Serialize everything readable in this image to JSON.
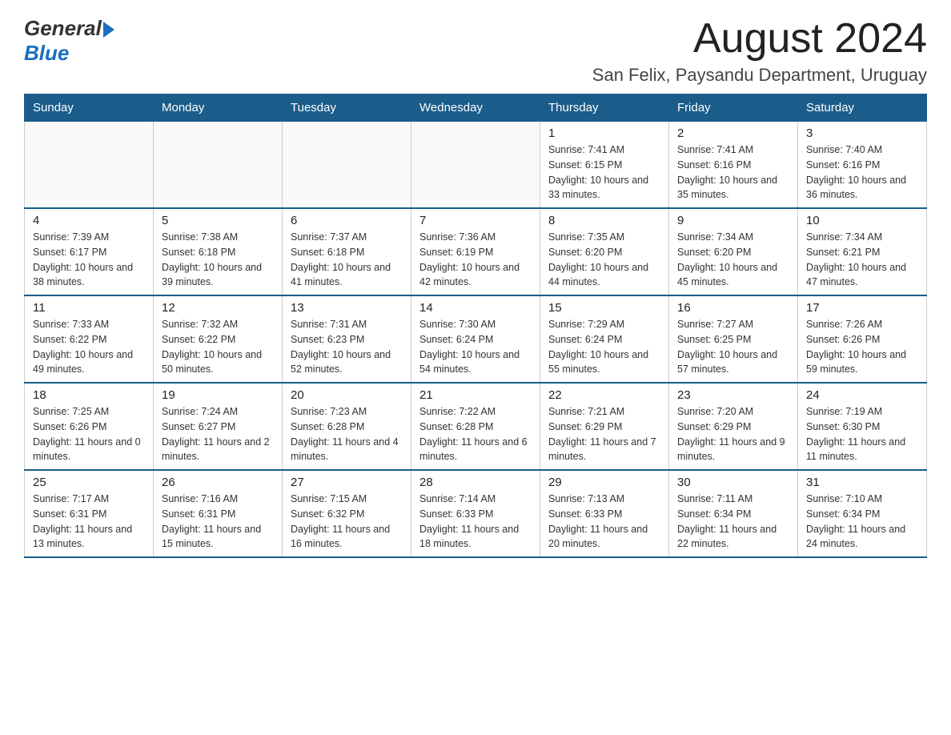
{
  "header": {
    "logo_general": "General",
    "logo_blue": "Blue",
    "month_title": "August 2024",
    "location": "San Felix, Paysandu Department, Uruguay"
  },
  "weekdays": [
    "Sunday",
    "Monday",
    "Tuesday",
    "Wednesday",
    "Thursday",
    "Friday",
    "Saturday"
  ],
  "weeks": [
    [
      {
        "day": "",
        "info": ""
      },
      {
        "day": "",
        "info": ""
      },
      {
        "day": "",
        "info": ""
      },
      {
        "day": "",
        "info": ""
      },
      {
        "day": "1",
        "info": "Sunrise: 7:41 AM\nSunset: 6:15 PM\nDaylight: 10 hours and 33 minutes."
      },
      {
        "day": "2",
        "info": "Sunrise: 7:41 AM\nSunset: 6:16 PM\nDaylight: 10 hours and 35 minutes."
      },
      {
        "day": "3",
        "info": "Sunrise: 7:40 AM\nSunset: 6:16 PM\nDaylight: 10 hours and 36 minutes."
      }
    ],
    [
      {
        "day": "4",
        "info": "Sunrise: 7:39 AM\nSunset: 6:17 PM\nDaylight: 10 hours and 38 minutes."
      },
      {
        "day": "5",
        "info": "Sunrise: 7:38 AM\nSunset: 6:18 PM\nDaylight: 10 hours and 39 minutes."
      },
      {
        "day": "6",
        "info": "Sunrise: 7:37 AM\nSunset: 6:18 PM\nDaylight: 10 hours and 41 minutes."
      },
      {
        "day": "7",
        "info": "Sunrise: 7:36 AM\nSunset: 6:19 PM\nDaylight: 10 hours and 42 minutes."
      },
      {
        "day": "8",
        "info": "Sunrise: 7:35 AM\nSunset: 6:20 PM\nDaylight: 10 hours and 44 minutes."
      },
      {
        "day": "9",
        "info": "Sunrise: 7:34 AM\nSunset: 6:20 PM\nDaylight: 10 hours and 45 minutes."
      },
      {
        "day": "10",
        "info": "Sunrise: 7:34 AM\nSunset: 6:21 PM\nDaylight: 10 hours and 47 minutes."
      }
    ],
    [
      {
        "day": "11",
        "info": "Sunrise: 7:33 AM\nSunset: 6:22 PM\nDaylight: 10 hours and 49 minutes."
      },
      {
        "day": "12",
        "info": "Sunrise: 7:32 AM\nSunset: 6:22 PM\nDaylight: 10 hours and 50 minutes."
      },
      {
        "day": "13",
        "info": "Sunrise: 7:31 AM\nSunset: 6:23 PM\nDaylight: 10 hours and 52 minutes."
      },
      {
        "day": "14",
        "info": "Sunrise: 7:30 AM\nSunset: 6:24 PM\nDaylight: 10 hours and 54 minutes."
      },
      {
        "day": "15",
        "info": "Sunrise: 7:29 AM\nSunset: 6:24 PM\nDaylight: 10 hours and 55 minutes."
      },
      {
        "day": "16",
        "info": "Sunrise: 7:27 AM\nSunset: 6:25 PM\nDaylight: 10 hours and 57 minutes."
      },
      {
        "day": "17",
        "info": "Sunrise: 7:26 AM\nSunset: 6:26 PM\nDaylight: 10 hours and 59 minutes."
      }
    ],
    [
      {
        "day": "18",
        "info": "Sunrise: 7:25 AM\nSunset: 6:26 PM\nDaylight: 11 hours and 0 minutes."
      },
      {
        "day": "19",
        "info": "Sunrise: 7:24 AM\nSunset: 6:27 PM\nDaylight: 11 hours and 2 minutes."
      },
      {
        "day": "20",
        "info": "Sunrise: 7:23 AM\nSunset: 6:28 PM\nDaylight: 11 hours and 4 minutes."
      },
      {
        "day": "21",
        "info": "Sunrise: 7:22 AM\nSunset: 6:28 PM\nDaylight: 11 hours and 6 minutes."
      },
      {
        "day": "22",
        "info": "Sunrise: 7:21 AM\nSunset: 6:29 PM\nDaylight: 11 hours and 7 minutes."
      },
      {
        "day": "23",
        "info": "Sunrise: 7:20 AM\nSunset: 6:29 PM\nDaylight: 11 hours and 9 minutes."
      },
      {
        "day": "24",
        "info": "Sunrise: 7:19 AM\nSunset: 6:30 PM\nDaylight: 11 hours and 11 minutes."
      }
    ],
    [
      {
        "day": "25",
        "info": "Sunrise: 7:17 AM\nSunset: 6:31 PM\nDaylight: 11 hours and 13 minutes."
      },
      {
        "day": "26",
        "info": "Sunrise: 7:16 AM\nSunset: 6:31 PM\nDaylight: 11 hours and 15 minutes."
      },
      {
        "day": "27",
        "info": "Sunrise: 7:15 AM\nSunset: 6:32 PM\nDaylight: 11 hours and 16 minutes."
      },
      {
        "day": "28",
        "info": "Sunrise: 7:14 AM\nSunset: 6:33 PM\nDaylight: 11 hours and 18 minutes."
      },
      {
        "day": "29",
        "info": "Sunrise: 7:13 AM\nSunset: 6:33 PM\nDaylight: 11 hours and 20 minutes."
      },
      {
        "day": "30",
        "info": "Sunrise: 7:11 AM\nSunset: 6:34 PM\nDaylight: 11 hours and 22 minutes."
      },
      {
        "day": "31",
        "info": "Sunrise: 7:10 AM\nSunset: 6:34 PM\nDaylight: 11 hours and 24 minutes."
      }
    ]
  ]
}
